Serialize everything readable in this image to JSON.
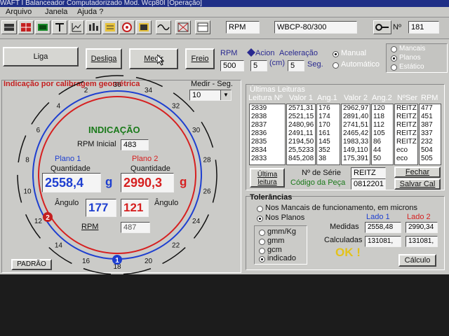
{
  "window": {
    "title": "WAFT I   Balanceador Computadorizado  Mod. Wcp80I   [Operação]"
  },
  "menu": [
    "Arquivo",
    "Janela",
    "Ajuda ?"
  ],
  "toolbar": {
    "rpm_label": "RPM",
    "model_value": "WBCP-80/300",
    "number_label": "Nº",
    "number_value": "181"
  },
  "controls": {
    "liga": "Liga",
    "desliga": "Desliga",
    "medir": "Medir",
    "freio": "Freio",
    "rpm_label": "RPM",
    "rpm_value": "500",
    "acion_label": "Acion",
    "acion_unit": "(cm)",
    "acion_value": "5",
    "acel_label": "Aceleração",
    "acel_unit": "Seg.",
    "acel_value": "5",
    "mode_manual": "Manual",
    "mode_auto": "Automático",
    "opt_a": "Mancais",
    "opt_b": "Planos",
    "opt_c": "Estático"
  },
  "left": {
    "title": "Indicação por calibragem geométrica",
    "medir_seg_label": "Medir - Seg.",
    "medir_seg_value": "10",
    "indicacao": "INDICAÇÃO",
    "rpm_inicial_label": "RPM Inicial",
    "rpm_inicial_value": "483",
    "plano1": "Plano 1",
    "plano2": "Plano 2",
    "quantidade": "Quantidade",
    "qty1": "2558,4",
    "qty2": "2990,3",
    "unit": "g",
    "angulo": "Ângulo",
    "ang1": "177",
    "ang2": "121",
    "rpm_label": "RPM",
    "rpm_value": "487",
    "padrao": "PADRÃO",
    "marker1": "1",
    "marker2": "2",
    "dial": [
      "36",
      "2",
      "4",
      "6",
      "8",
      "10",
      "12",
      "14",
      "16",
      "18",
      "20",
      "22",
      "24",
      "26",
      "28",
      "30",
      "32",
      "34"
    ]
  },
  "ultimas": {
    "title": "Últimas Leituras",
    "headers": [
      "Leitura Nº",
      "Valor 1",
      "Ang.1",
      "Valor 2",
      "Ang.2",
      "NºSer",
      "RPM"
    ],
    "leitura": [
      "2839",
      "2838",
      "2837",
      "2836",
      "2835",
      "2834",
      "2833"
    ],
    "valor1": [
      "2571,31",
      "2521,15",
      "2480,96",
      "2491,11",
      "2194,50",
      "25,5233",
      "845,208"
    ],
    "ang1": [
      "176",
      "174",
      "170",
      "161",
      "145",
      "352",
      "38"
    ],
    "valor2": [
      "2962,97",
      "2891,40",
      "2741,51",
      "2465,42",
      "1983,33",
      "149,110",
      "175,391"
    ],
    "ang2": [
      "120",
      "118",
      "112",
      "105",
      "86",
      "44",
      "50"
    ],
    "nser": [
      "REITZ",
      "REITZ",
      "REITZ",
      "REITZ",
      "REITZ",
      "eco",
      "eco"
    ],
    "rpm": [
      "477",
      "451",
      "387",
      "337",
      "232",
      "504",
      "505"
    ],
    "btn_ultima": "Última leitura",
    "nserie_label": "Nº de Série",
    "nserie_value": "REITZ",
    "codpeca_label": "Código da Peça",
    "codpeca_value": "0812201",
    "btn_fechar": "Fechar",
    "btn_salvar": "Salvar Cal"
  },
  "tolerancias": {
    "title": "Tolerâncias",
    "opt_mancais": "Nos Mancais de funcionamento, em microns",
    "opt_planos": "Nos Planos",
    "units": [
      "gmm/Kg",
      "gmm",
      "gcm",
      "indicado"
    ],
    "lado1": "Lado 1",
    "lado2": "Lado 2",
    "medidas_label": "Medidas",
    "medidas1": "2558,48",
    "medidas2": "2990,34",
    "calculadas_label": "Calculadas",
    "calc1": "131081,",
    "calc2": "131081,",
    "ok": "OK !",
    "btn_calculo": "Cálculo"
  },
  "colors": {
    "blue_circle": "#1e3fd0",
    "red_circle": "#d62020",
    "indicacao_green": "#1a7a1a",
    "ok_yellow": "#e3c21b",
    "title_blue": "#1f2f86"
  }
}
